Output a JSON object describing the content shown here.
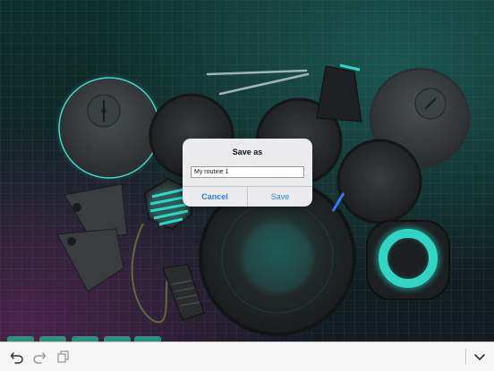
{
  "dialog": {
    "title": "Save as",
    "input_value": "My routine 1",
    "cancel_label": "Cancel",
    "save_label": "Save"
  },
  "toolbar": {
    "icons": [
      "undo-icon",
      "redo-icon",
      "copy-icon",
      "chevron-down-icon"
    ]
  },
  "colors": {
    "accent": "#2f7cf6",
    "teal_glow": "#2fd6c3",
    "toolbar_bg": "#f6f6f6"
  }
}
